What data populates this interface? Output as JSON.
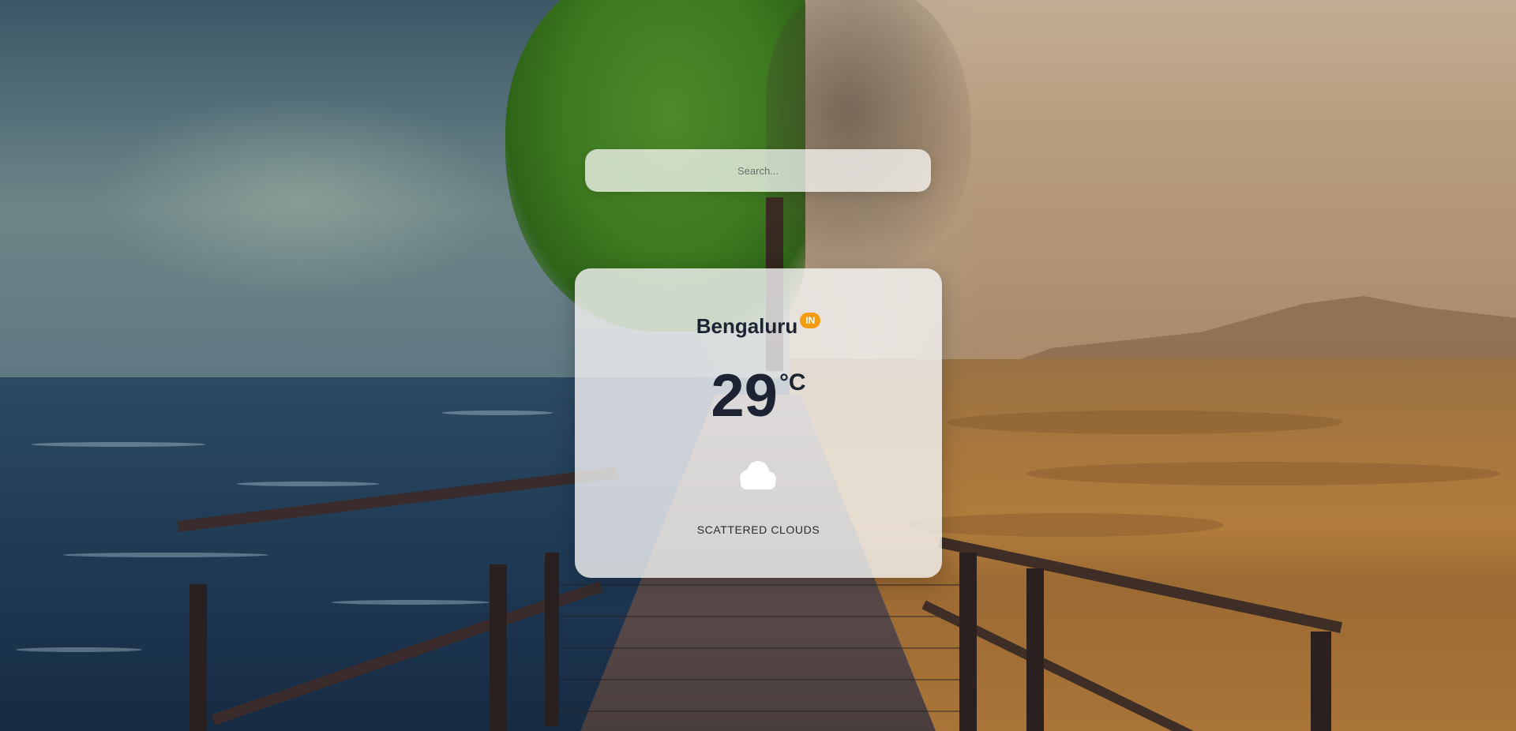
{
  "search": {
    "placeholder": "Search..."
  },
  "weather": {
    "city": "Bengaluru",
    "country": "IN",
    "temperature": "29",
    "unit": "°C",
    "icon": "cloud-icon",
    "description": "SCATTERED CLOUDS"
  },
  "colors": {
    "badge": "#f39c12",
    "text_primary": "#1e2333",
    "card_background": "#f5f5f5",
    "icon_fill": "#ffffff"
  }
}
